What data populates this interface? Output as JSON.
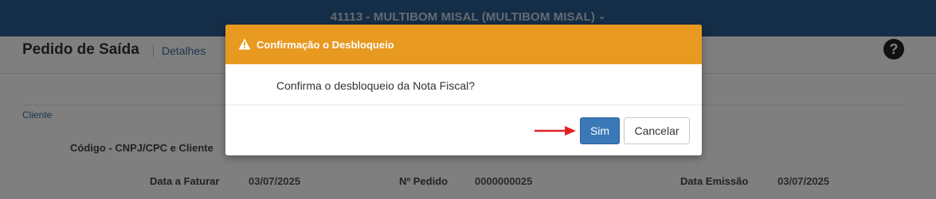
{
  "topbar": {
    "company": "41113 - MULTIBOM MISAL (MULTIBOM MISAL)",
    "caret": "⌄"
  },
  "page": {
    "title": "Pedido de Saída",
    "subtitle": "Detalhes",
    "help_icon": "?",
    "section": "Cliente",
    "fields": {
      "codigo_label": "Código - CNPJ/CPC e Cliente",
      "data_faturar_label": "Data a Faturar",
      "data_faturar_value": "03/07/2025",
      "pedido_label": "Nº Pedido",
      "pedido_value": "0000000025",
      "data_emissao_label": "Data Emissão",
      "data_emissao_value": "03/07/2025"
    }
  },
  "modal": {
    "title": "Confirmação o Desbloqueio",
    "message": "Confirma o desbloqueio da Nota Fiscal?",
    "confirm_label": "Sim",
    "cancel_label": "Cancelar",
    "header_color": "#e8991f",
    "icon": "warning-icon"
  }
}
